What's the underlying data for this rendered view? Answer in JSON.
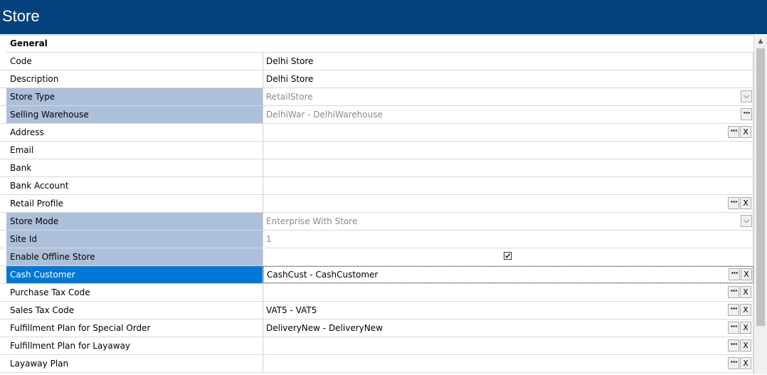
{
  "window": {
    "title": "Store"
  },
  "section": {
    "title": "General"
  },
  "rows": [
    {
      "label": "Code",
      "value": "Delhi Store",
      "state": "normal"
    },
    {
      "label": "Description",
      "value": "Delhi Store",
      "state": "normal"
    },
    {
      "label": "Store Type",
      "value": "RetailStore",
      "state": "readonly"
    },
    {
      "label": "Selling Warehouse",
      "value": "DelhiWar - DelhiWarehouse",
      "state": "readonly"
    },
    {
      "label": "Address",
      "value": "",
      "state": "normal"
    },
    {
      "label": "Email",
      "value": "",
      "state": "normal"
    },
    {
      "label": "Bank",
      "value": "",
      "state": "normal"
    },
    {
      "label": "Bank Account",
      "value": "",
      "state": "normal"
    },
    {
      "label": "Retail Profile",
      "value": "",
      "state": "normal"
    },
    {
      "label": "Store Mode",
      "value": "Enterprise With Store",
      "state": "readonly"
    },
    {
      "label": "Site Id",
      "value": "1",
      "state": "readonly"
    },
    {
      "label": "Enable Offline Store",
      "value": "",
      "state": "readonly",
      "checked": true
    },
    {
      "label": "Cash Customer",
      "value": "CashCust - CashCustomer",
      "state": "selected"
    },
    {
      "label": "Purchase Tax Code",
      "value": "",
      "state": "normal"
    },
    {
      "label": "Sales Tax Code",
      "value": "VAT5 - VAT5",
      "state": "normal"
    },
    {
      "label": "Fulfillment Plan for Special Order",
      "value": "DeliveryNew - DeliveryNew",
      "state": "normal"
    },
    {
      "label": "Fulfillment Plan for Layaway",
      "value": "",
      "state": "normal"
    },
    {
      "label": "Layaway Plan",
      "value": "",
      "state": "normal"
    }
  ],
  "buttons": {
    "ellipsis": "···",
    "clear": "X",
    "dropdown": "⌵"
  },
  "colors": {
    "titlebar": "#05427d",
    "readonly_label": "#adc0db",
    "selected": "#0078d7"
  }
}
